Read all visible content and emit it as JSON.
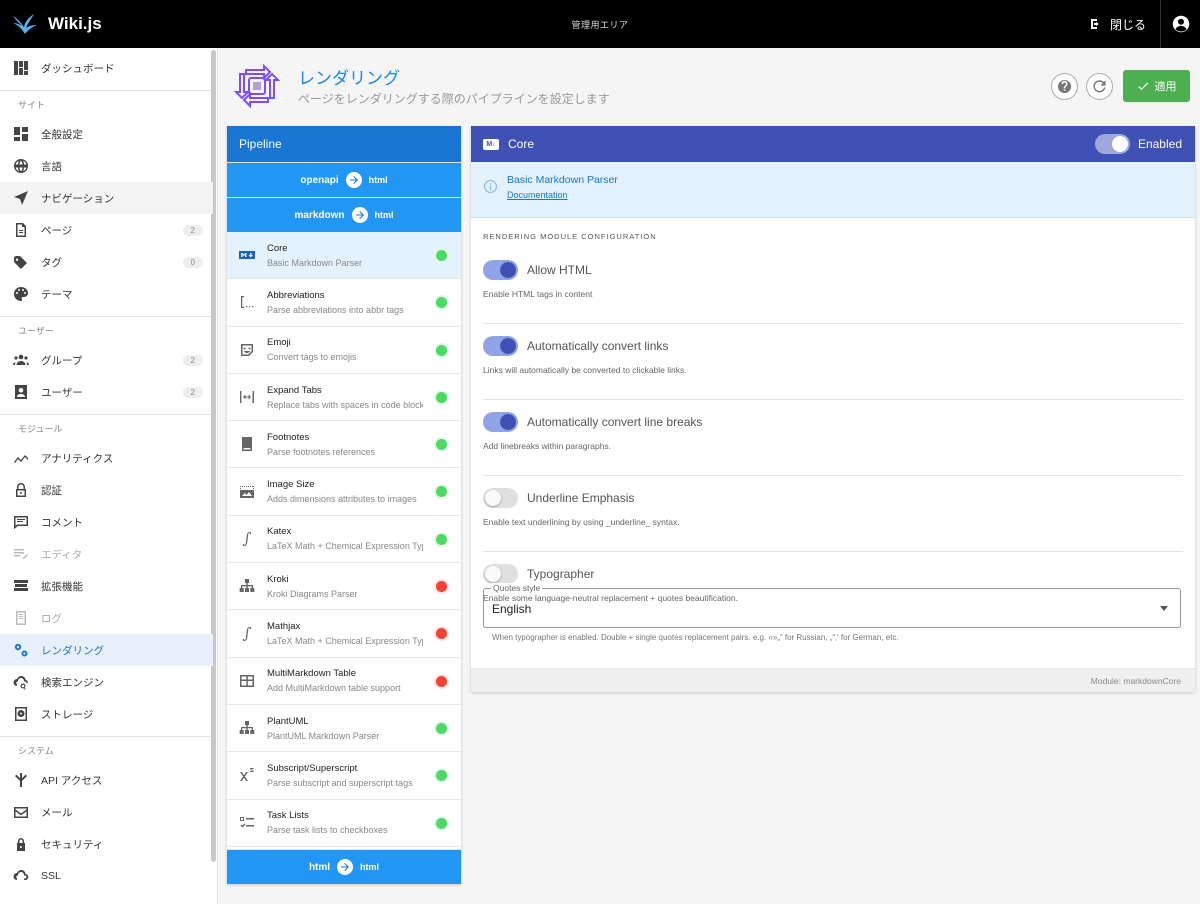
{
  "topbar": {
    "brand": "Wiki.js",
    "area": "管理用エリア",
    "close_label": "閉じる"
  },
  "sidebar": {
    "dashboard": "ダッシュボード",
    "sections": {
      "site": "サイト",
      "users": "ユーザー",
      "modules": "モジュール",
      "system": "システム"
    },
    "site_items": [
      {
        "label": "全般設定",
        "icon": "grid-icon"
      },
      {
        "label": "言語",
        "icon": "globe-icon"
      },
      {
        "label": "ナビゲーション",
        "icon": "navigation-icon"
      },
      {
        "label": "ページ",
        "icon": "page-icon",
        "count": "2"
      },
      {
        "label": "タグ",
        "icon": "tag-icon",
        "count": "0"
      },
      {
        "label": "テーマ",
        "icon": "palette-icon"
      }
    ],
    "user_items": [
      {
        "label": "グループ",
        "icon": "group-icon",
        "count": "2"
      },
      {
        "label": "ユーザー",
        "icon": "user-icon",
        "count": "2"
      }
    ],
    "module_items": [
      {
        "label": "アナリティクス",
        "icon": "analytics-icon"
      },
      {
        "label": "認証",
        "icon": "lock-icon"
      },
      {
        "label": "コメント",
        "icon": "comment-icon"
      },
      {
        "label": "エディタ",
        "icon": "editor-icon"
      },
      {
        "label": "拡張機能",
        "icon": "extension-icon"
      },
      {
        "label": "ログ",
        "icon": "log-icon"
      },
      {
        "label": "レンダリング",
        "icon": "rendering-icon"
      },
      {
        "label": "検索エンジン",
        "icon": "search-engine-icon"
      },
      {
        "label": "ストレージ",
        "icon": "storage-icon"
      }
    ],
    "system_items": [
      {
        "label": "API アクセス",
        "icon": "api-icon"
      },
      {
        "label": "メール",
        "icon": "mail-icon"
      },
      {
        "label": "セキュリティ",
        "icon": "security-icon"
      },
      {
        "label": "SSL",
        "icon": "ssl-icon"
      }
    ]
  },
  "header": {
    "title": "レンダリング",
    "subtitle": "ページをレンダリングする際のパイプラインを設定します",
    "apply_label": "適用"
  },
  "pipeline": {
    "title": "Pipeline",
    "steps": [
      {
        "from": "openapi",
        "to": "html"
      },
      {
        "from": "markdown",
        "to": "html"
      }
    ],
    "renderers": [
      {
        "title": "Core",
        "desc": "Basic Markdown Parser",
        "enabled": true,
        "icon": "markdown-icon"
      },
      {
        "title": "Abbreviations",
        "desc": "Parse abbreviations into abbr tags",
        "enabled": true,
        "icon": "abbreviation-icon"
      },
      {
        "title": "Emoji",
        "desc": "Convert tags to emojis",
        "enabled": true,
        "icon": "emoji-icon"
      },
      {
        "title": "Expand Tabs",
        "desc": "Replace tabs with spaces in code blocks",
        "enabled": true,
        "icon": "expand-tabs-icon"
      },
      {
        "title": "Footnotes",
        "desc": "Parse footnotes references",
        "enabled": true,
        "icon": "footnote-icon"
      },
      {
        "title": "Image Size",
        "desc": "Adds dimensions attributes to images",
        "enabled": true,
        "icon": "image-size-icon"
      },
      {
        "title": "Katex",
        "desc": "LaTeX Math + Chemical Expression Typesetting",
        "enabled": true,
        "icon": "integral-icon"
      },
      {
        "title": "Kroki",
        "desc": "Kroki Diagrams Parser",
        "enabled": false,
        "icon": "diagram-icon"
      },
      {
        "title": "Mathjax",
        "desc": "LaTeX Math + Chemical Expression Typesetting",
        "enabled": false,
        "icon": "integral-icon"
      },
      {
        "title": "MultiMarkdown Table",
        "desc": "Add MultiMarkdown table support",
        "enabled": false,
        "icon": "table-icon"
      },
      {
        "title": "PlantUML",
        "desc": "PlantUML Markdown Parser",
        "enabled": true,
        "icon": "diagram-icon"
      },
      {
        "title": "Subscript/Superscript",
        "desc": "Parse subscript and superscript tags",
        "enabled": true,
        "icon": "superscript-icon"
      },
      {
        "title": "Task Lists",
        "desc": "Parse task lists to checkboxes",
        "enabled": true,
        "icon": "checklist-icon"
      }
    ],
    "footer": {
      "from": "html",
      "to": "html"
    }
  },
  "config": {
    "title": "Core",
    "enabled_label": "Enabled",
    "info_title": "Basic Markdown Parser",
    "info_link": "Documentation",
    "section_label": "RENDERING MODULE CONFIGURATION",
    "options": [
      {
        "label": "Allow HTML",
        "hint": "Enable HTML tags in content",
        "on": true
      },
      {
        "label": "Automatically convert links",
        "hint": "Links will automatically be converted to clickable links.",
        "on": true
      },
      {
        "label": "Automatically convert line breaks",
        "hint": "Add linebreaks within paragraphs.",
        "on": true
      },
      {
        "label": "Underline Emphasis",
        "hint": "Enable text underlining by using _underline_ syntax.",
        "on": false
      },
      {
        "label": "Typographer",
        "hint": "Enable some language-neutral replacement + quotes beautification.",
        "on": false
      }
    ],
    "quotes": {
      "legend": "Quotes style",
      "value": "English",
      "hint": "When typographer is enabled. Double + single quotes replacement pairs. e.g. «»„“ for Russian, „“‚‘ for German, etc."
    },
    "module_name": "Module: markdownCore"
  },
  "colors": {
    "topbar": "#000000",
    "primary": "#1976d2",
    "pipeline_step": "#2196f3",
    "config_header": "#3f51b5",
    "apply": "#4caf50",
    "enabled_dot": "#4cd964",
    "disabled_dot": "#f44336"
  }
}
